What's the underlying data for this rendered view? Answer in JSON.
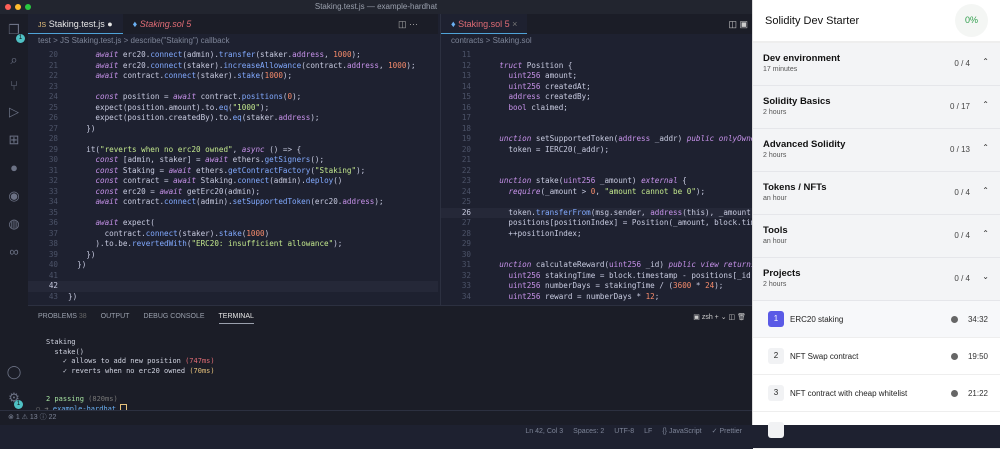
{
  "window": {
    "title": "Staking.test.js — example-hardhat"
  },
  "left_editor": {
    "tabs": [
      {
        "label": "Staking.test.js",
        "icon": "js-icon",
        "modified": true
      },
      {
        "label": "Staking.sol 5",
        "icon": "solidity-icon"
      }
    ],
    "breadcrumb": "test > JS Staking.test.js > describe(\"Staking\") callback",
    "current_line": 42,
    "lines": [
      [
        20,
        "      await erc20.connect(admin).transfer(staker.address, 1000);"
      ],
      [
        21,
        "      await erc20.connect(staker).increaseAllowance(contract.address, 1000);"
      ],
      [
        22,
        "      await contract.connect(staker).stake(1000);"
      ],
      [
        23,
        ""
      ],
      [
        24,
        "      const position = await contract.positions(0);"
      ],
      [
        25,
        "      expect(position.amount).to.eq(\"1000\");"
      ],
      [
        26,
        "      expect(position.createdBy).to.eq(staker.address);"
      ],
      [
        27,
        "    })"
      ],
      [
        28,
        ""
      ],
      [
        29,
        "    it(\"reverts when no erc20 owned\", async () => {"
      ],
      [
        30,
        "      const [admin, staker] = await ethers.getSigners();"
      ],
      [
        31,
        "      const Staking = await ethers.getContractFactory(\"Staking\");"
      ],
      [
        32,
        "      const contract = await Staking.connect(admin).deploy()"
      ],
      [
        33,
        "      const erc20 = await getErc20(admin);"
      ],
      [
        34,
        "      await contract.connect(admin).setSupportedToken(erc20.address);"
      ],
      [
        35,
        ""
      ],
      [
        36,
        "      await expect("
      ],
      [
        37,
        "        contract.connect(staker).stake(1000)"
      ],
      [
        38,
        "      ).to.be.revertedWith(\"ERC20: insufficient allowance\");"
      ],
      [
        39,
        "    })"
      ],
      [
        40,
        "  })"
      ],
      [
        41,
        ""
      ],
      [
        42,
        "  "
      ],
      [
        43,
        "})"
      ]
    ]
  },
  "right_editor": {
    "tabs": [
      {
        "label": "Staking.sol 5",
        "icon": "solidity-icon"
      }
    ],
    "breadcrumb": "contracts > Staking.sol",
    "current_line": 26,
    "lines": [
      [
        11,
        ""
      ],
      [
        12,
        "    truct Position {"
      ],
      [
        13,
        "      uint256 amount;"
      ],
      [
        14,
        "      uint256 createdAt;"
      ],
      [
        15,
        "      address createdBy;"
      ],
      [
        16,
        "      bool claimed;"
      ],
      [
        17,
        ""
      ],
      [
        18,
        ""
      ],
      [
        19,
        "    unction setSupportedToken(address _addr) public onlyOwner {"
      ],
      [
        20,
        "      token = IERC20(_addr);"
      ],
      [
        21,
        ""
      ],
      [
        22,
        ""
      ],
      [
        23,
        "    unction stake(uint256 _amount) external {"
      ],
      [
        24,
        "      require(_amount > 0, \"amount cannot be 0\");"
      ],
      [
        25,
        ""
      ],
      [
        26,
        "      token.transferFrom(msg.sender, address(this), _amount);"
      ],
      [
        27,
        "      positions[positionIndex] = Position(_amount, block.timestam"
      ],
      [
        28,
        "      ++positionIndex;"
      ],
      [
        29,
        ""
      ],
      [
        30,
        ""
      ],
      [
        31,
        "    unction calculateReward(uint256 _id) public view returns(uint2"
      ],
      [
        32,
        "      uint256 stakingTime = block.timestamp - positions[_id].crea"
      ],
      [
        33,
        "      uint256 numberDays = stakingTime / (3600 * 24);"
      ],
      [
        34,
        "      uint256 reward = numberDays * 12;"
      ]
    ]
  },
  "panel": {
    "tabs": [
      {
        "label": "PROBLEMS",
        "count": "38"
      },
      {
        "label": "OUTPUT"
      },
      {
        "label": "DEBUG CONSOLE"
      },
      {
        "label": "TERMINAL",
        "active": true
      }
    ],
    "shell": "zsh",
    "terminal": {
      "suite": "Staking",
      "group": "stake()",
      "tests": [
        {
          "name": "allows to add new position",
          "time": "(747ms)",
          "time_color": "#e06c75"
        },
        {
          "name": "reverts when no erc20 owned",
          "time": "(70ms)",
          "time_color": "#e5c07b"
        }
      ],
      "summary": "2 passing",
      "summary_time": "(820ms)",
      "prompt": "example-hardhat"
    }
  },
  "status": {
    "errors": "1",
    "warnings": "13",
    "info": "22",
    "position": "Ln 42, Col 3",
    "spaces": "Spaces: 2",
    "encoding": "UTF-8",
    "eol": "LF",
    "language": "JavaScript",
    "formatter": "Prettier"
  },
  "course": {
    "title": "Solidity Dev Starter",
    "progress": "0%",
    "progress_value": 0,
    "sections": [
      {
        "title": "Dev environment",
        "duration": "17 minutes",
        "count": "0 / 4",
        "expanded": false
      },
      {
        "title": "Solidity Basics",
        "duration": "2 hours",
        "count": "0 / 17",
        "expanded": false
      },
      {
        "title": "Advanced Solidity",
        "duration": "2 hours",
        "count": "0 / 13",
        "expanded": false
      },
      {
        "title": "Tokens / NFTs",
        "duration": "an hour",
        "count": "0 / 4",
        "expanded": false
      },
      {
        "title": "Tools",
        "duration": "an hour",
        "count": "0 / 4",
        "expanded": false
      },
      {
        "title": "Projects",
        "duration": "2 hours",
        "count": "0 / 4",
        "expanded": true
      }
    ],
    "lessons": [
      {
        "num": "1",
        "title": "ERC20 staking",
        "duration": "34:32",
        "active": true
      },
      {
        "num": "2",
        "title": "NFT Swap contract",
        "duration": "19:50"
      },
      {
        "num": "3",
        "title": "NFT contract with cheap whitelist",
        "duration": "21:22"
      }
    ]
  },
  "colors": {
    "accent": "#5a5ae6",
    "progress": "#2e9d4a",
    "tab_modified": "#e06c75"
  }
}
